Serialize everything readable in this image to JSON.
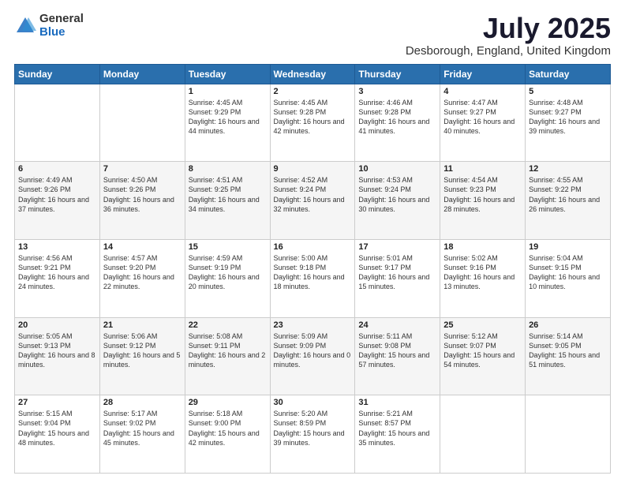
{
  "logo": {
    "general": "General",
    "blue": "Blue"
  },
  "title": "July 2025",
  "subtitle": "Desborough, England, United Kingdom",
  "days_of_week": [
    "Sunday",
    "Monday",
    "Tuesday",
    "Wednesday",
    "Thursday",
    "Friday",
    "Saturday"
  ],
  "weeks": [
    [
      {
        "day": "",
        "sunrise": "",
        "sunset": "",
        "daylight": ""
      },
      {
        "day": "",
        "sunrise": "",
        "sunset": "",
        "daylight": ""
      },
      {
        "day": "1",
        "sunrise": "Sunrise: 4:45 AM",
        "sunset": "Sunset: 9:29 PM",
        "daylight": "Daylight: 16 hours and 44 minutes."
      },
      {
        "day": "2",
        "sunrise": "Sunrise: 4:45 AM",
        "sunset": "Sunset: 9:28 PM",
        "daylight": "Daylight: 16 hours and 42 minutes."
      },
      {
        "day": "3",
        "sunrise": "Sunrise: 4:46 AM",
        "sunset": "Sunset: 9:28 PM",
        "daylight": "Daylight: 16 hours and 41 minutes."
      },
      {
        "day": "4",
        "sunrise": "Sunrise: 4:47 AM",
        "sunset": "Sunset: 9:27 PM",
        "daylight": "Daylight: 16 hours and 40 minutes."
      },
      {
        "day": "5",
        "sunrise": "Sunrise: 4:48 AM",
        "sunset": "Sunset: 9:27 PM",
        "daylight": "Daylight: 16 hours and 39 minutes."
      }
    ],
    [
      {
        "day": "6",
        "sunrise": "Sunrise: 4:49 AM",
        "sunset": "Sunset: 9:26 PM",
        "daylight": "Daylight: 16 hours and 37 minutes."
      },
      {
        "day": "7",
        "sunrise": "Sunrise: 4:50 AM",
        "sunset": "Sunset: 9:26 PM",
        "daylight": "Daylight: 16 hours and 36 minutes."
      },
      {
        "day": "8",
        "sunrise": "Sunrise: 4:51 AM",
        "sunset": "Sunset: 9:25 PM",
        "daylight": "Daylight: 16 hours and 34 minutes."
      },
      {
        "day": "9",
        "sunrise": "Sunrise: 4:52 AM",
        "sunset": "Sunset: 9:24 PM",
        "daylight": "Daylight: 16 hours and 32 minutes."
      },
      {
        "day": "10",
        "sunrise": "Sunrise: 4:53 AM",
        "sunset": "Sunset: 9:24 PM",
        "daylight": "Daylight: 16 hours and 30 minutes."
      },
      {
        "day": "11",
        "sunrise": "Sunrise: 4:54 AM",
        "sunset": "Sunset: 9:23 PM",
        "daylight": "Daylight: 16 hours and 28 minutes."
      },
      {
        "day": "12",
        "sunrise": "Sunrise: 4:55 AM",
        "sunset": "Sunset: 9:22 PM",
        "daylight": "Daylight: 16 hours and 26 minutes."
      }
    ],
    [
      {
        "day": "13",
        "sunrise": "Sunrise: 4:56 AM",
        "sunset": "Sunset: 9:21 PM",
        "daylight": "Daylight: 16 hours and 24 minutes."
      },
      {
        "day": "14",
        "sunrise": "Sunrise: 4:57 AM",
        "sunset": "Sunset: 9:20 PM",
        "daylight": "Daylight: 16 hours and 22 minutes."
      },
      {
        "day": "15",
        "sunrise": "Sunrise: 4:59 AM",
        "sunset": "Sunset: 9:19 PM",
        "daylight": "Daylight: 16 hours and 20 minutes."
      },
      {
        "day": "16",
        "sunrise": "Sunrise: 5:00 AM",
        "sunset": "Sunset: 9:18 PM",
        "daylight": "Daylight: 16 hours and 18 minutes."
      },
      {
        "day": "17",
        "sunrise": "Sunrise: 5:01 AM",
        "sunset": "Sunset: 9:17 PM",
        "daylight": "Daylight: 16 hours and 15 minutes."
      },
      {
        "day": "18",
        "sunrise": "Sunrise: 5:02 AM",
        "sunset": "Sunset: 9:16 PM",
        "daylight": "Daylight: 16 hours and 13 minutes."
      },
      {
        "day": "19",
        "sunrise": "Sunrise: 5:04 AM",
        "sunset": "Sunset: 9:15 PM",
        "daylight": "Daylight: 16 hours and 10 minutes."
      }
    ],
    [
      {
        "day": "20",
        "sunrise": "Sunrise: 5:05 AM",
        "sunset": "Sunset: 9:13 PM",
        "daylight": "Daylight: 16 hours and 8 minutes."
      },
      {
        "day": "21",
        "sunrise": "Sunrise: 5:06 AM",
        "sunset": "Sunset: 9:12 PM",
        "daylight": "Daylight: 16 hours and 5 minutes."
      },
      {
        "day": "22",
        "sunrise": "Sunrise: 5:08 AM",
        "sunset": "Sunset: 9:11 PM",
        "daylight": "Daylight: 16 hours and 2 minutes."
      },
      {
        "day": "23",
        "sunrise": "Sunrise: 5:09 AM",
        "sunset": "Sunset: 9:09 PM",
        "daylight": "Daylight: 16 hours and 0 minutes."
      },
      {
        "day": "24",
        "sunrise": "Sunrise: 5:11 AM",
        "sunset": "Sunset: 9:08 PM",
        "daylight": "Daylight: 15 hours and 57 minutes."
      },
      {
        "day": "25",
        "sunrise": "Sunrise: 5:12 AM",
        "sunset": "Sunset: 9:07 PM",
        "daylight": "Daylight: 15 hours and 54 minutes."
      },
      {
        "day": "26",
        "sunrise": "Sunrise: 5:14 AM",
        "sunset": "Sunset: 9:05 PM",
        "daylight": "Daylight: 15 hours and 51 minutes."
      }
    ],
    [
      {
        "day": "27",
        "sunrise": "Sunrise: 5:15 AM",
        "sunset": "Sunset: 9:04 PM",
        "daylight": "Daylight: 15 hours and 48 minutes."
      },
      {
        "day": "28",
        "sunrise": "Sunrise: 5:17 AM",
        "sunset": "Sunset: 9:02 PM",
        "daylight": "Daylight: 15 hours and 45 minutes."
      },
      {
        "day": "29",
        "sunrise": "Sunrise: 5:18 AM",
        "sunset": "Sunset: 9:00 PM",
        "daylight": "Daylight: 15 hours and 42 minutes."
      },
      {
        "day": "30",
        "sunrise": "Sunrise: 5:20 AM",
        "sunset": "Sunset: 8:59 PM",
        "daylight": "Daylight: 15 hours and 39 minutes."
      },
      {
        "day": "31",
        "sunrise": "Sunrise: 5:21 AM",
        "sunset": "Sunset: 8:57 PM",
        "daylight": "Daylight: 15 hours and 35 minutes."
      },
      {
        "day": "",
        "sunrise": "",
        "sunset": "",
        "daylight": ""
      },
      {
        "day": "",
        "sunrise": "",
        "sunset": "",
        "daylight": ""
      }
    ]
  ]
}
